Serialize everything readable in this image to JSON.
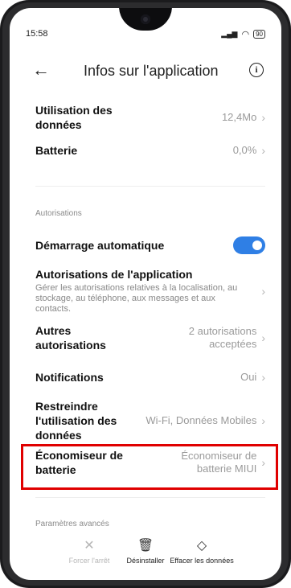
{
  "status": {
    "time": "15:58",
    "battery": "90"
  },
  "header": {
    "title": "Infos sur l'application"
  },
  "rows": {
    "data_usage": {
      "label": "Utilisation des données",
      "value": "12,4Mo"
    },
    "battery": {
      "label": "Batterie",
      "value": "0,0%"
    }
  },
  "sections": {
    "permissions": "Autorisations",
    "advanced": "Paramètres avancés"
  },
  "permissions": {
    "autostart": {
      "label": "Démarrage automatique",
      "enabled": true
    },
    "app_permissions": {
      "label": "Autorisations de l'application",
      "subtitle": "Gérer les autorisations relatives à la localisation, au stockage, au téléphone, aux messages et aux contacts."
    },
    "other": {
      "label": "Autres autorisations",
      "value": "2 autorisations acceptées"
    },
    "notifications": {
      "label": "Notifications",
      "value": "Oui"
    },
    "restrict_data": {
      "label": "Restreindre l'utilisation des données",
      "value": "Wi-Fi, Données Mobiles"
    },
    "battery_saver": {
      "label": "Économiseur de batterie",
      "value": "Économiseur de batterie MIUI"
    }
  },
  "bottom": {
    "force_stop": "Forcer l'arrêt",
    "uninstall": "Désinstaller",
    "clear_data": "Effacer les données"
  },
  "colors": {
    "accent": "#2f7fe5",
    "highlight": "#e00000"
  }
}
